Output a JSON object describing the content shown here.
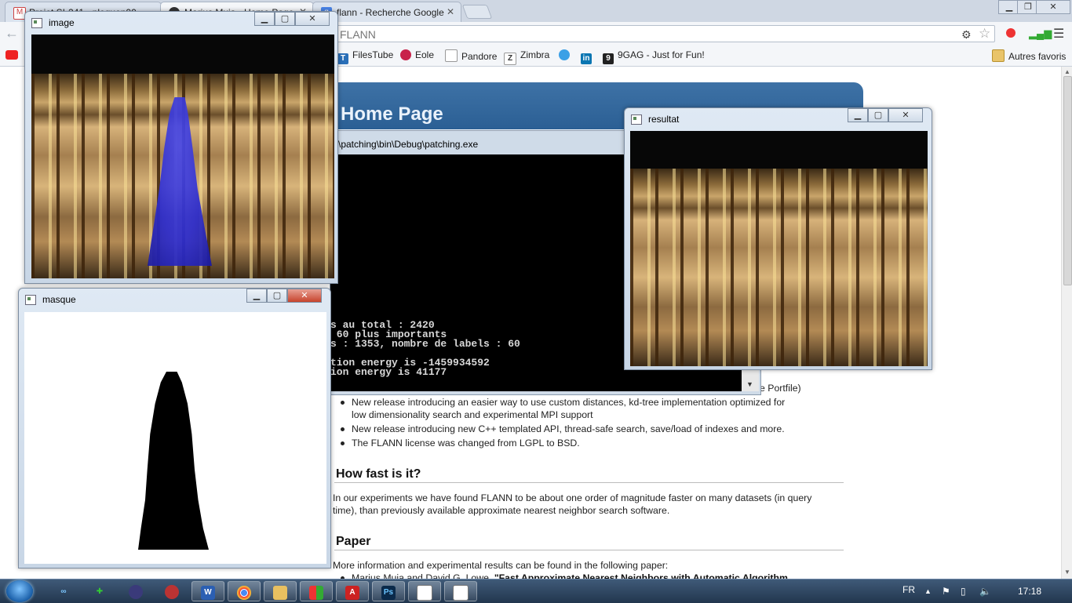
{
  "browser": {
    "tabs": [
      {
        "label": "Projet SI-241 - plequen00",
        "favicon": "gmail-icon",
        "active": false
      },
      {
        "label": "Marius Muja - Home Page",
        "favicon": "penguin-icon",
        "active": true
      },
      {
        "label": "flann - Recherche Google",
        "favicon": "google-icon",
        "active": false
      }
    ],
    "address": "FLANN",
    "bookmarks": [
      {
        "label": "FilesTube",
        "icon": "filestube-icon"
      },
      {
        "label": "Eole",
        "icon": "eole-icon"
      },
      {
        "label": "Pandore",
        "icon": "page-icon"
      },
      {
        "label": "Zimbra",
        "icon": "zimbra-icon"
      },
      {
        "label": "",
        "icon": "twitter-icon"
      },
      {
        "label": "",
        "icon": "linkedin-icon"
      },
      {
        "label": "9GAG - Just for Fun!",
        "icon": "9gag-icon"
      }
    ],
    "other_bookmarks": "Autres favoris"
  },
  "webpage": {
    "title": "Home Page",
    "news": [
      "New release introducing an easier way to use custom distances, kd-tree implementation optimized for",
      "low dimensionality search and experimental MPI support",
      "New release introducing new C++ templated API, thread-safe search, save/load of indexes and more.",
      "The FLANN license was changed from LGPL to BSD."
    ],
    "news_tail": "e Portfile)",
    "section_fast": "How fast is it?",
    "fast_text_1": "In our experiments we have found FLANN to be about one order of magnitude faster on many datasets (in query",
    "fast_text_2": "time), than previously available approximate nearest neighbor search software.",
    "section_paper": "Paper",
    "paper_text": "More information and experimental results can be found in the following paper:",
    "paper_item_authors": "Marius Muja and David G. Lowe,",
    "paper_item_title": "\"Fast Approximate Nearest Neighbors with Automatic Algorithm"
  },
  "console": {
    "title": "\\patching\\bin\\Debug\\patching.exe",
    "lines": [
      "s au total : 2420",
      " 60 plus importants",
      "s : 1353, nombre de labels : 60",
      "",
      "tion energy is -1459934592",
      "ion energy is 41177"
    ]
  },
  "windows": {
    "image": {
      "title": "image"
    },
    "masque": {
      "title": "masque"
    },
    "resultat": {
      "title": "resultat"
    }
  },
  "taskbar": {
    "lang": "FR",
    "clock": "17:18",
    "apps": [
      "ie-icon",
      "green-app-icon",
      "eclipse-icon",
      "media-icon",
      "word-icon",
      "chrome-icon",
      "explorer-icon",
      "paint-icon",
      "acrobat-icon",
      "photoshop-icon",
      "opencv-window-icon",
      "opencv-window-icon"
    ]
  }
}
